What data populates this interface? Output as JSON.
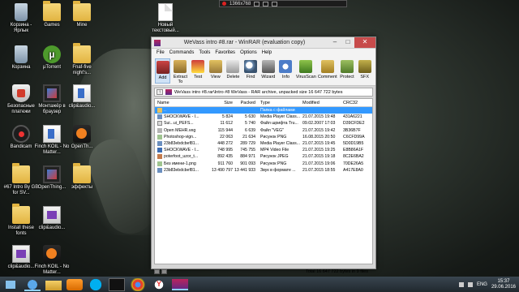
{
  "recording": {
    "resolution": "1366x768"
  },
  "desktop": {
    "icons": [
      {
        "label": "Корзина - Ярлык",
        "icon": "bin-icon"
      },
      {
        "label": "Games",
        "icon": "folder-icon"
      },
      {
        "label": "Mine",
        "icon": "folder-icon"
      },
      {
        "label": "Новый текстовый...",
        "icon": "text-doc-icon"
      },
      {
        "label": "Корзина",
        "icon": "bin-icon"
      },
      {
        "label": "µTorrent",
        "icon": "utorrent-icon"
      },
      {
        "label": "Fnaf-five night's...",
        "icon": "folder-icon"
      },
      {
        "label": "Безопасные платежи",
        "icon": "shield-icon"
      },
      {
        "label": "Монтажёр в браузер",
        "icon": "film-icon"
      },
      {
        "label": "clip&audio...",
        "icon": "media-icon"
      },
      {
        "label": "Bandicam",
        "icon": "bandicam-icon"
      },
      {
        "label": "Finch KOIL - No Matter...",
        "icon": "media-icon"
      },
      {
        "label": "OpenTh...",
        "icon": "klite-icon"
      },
      {
        "label": "#67 Intro By GB for SV...",
        "icon": "folder-icon"
      },
      {
        "label": "OpenThing...",
        "icon": "film-icon"
      },
      {
        "label": "эффекты",
        "icon": "folder-icon"
      },
      {
        "label": "Install these fonts",
        "icon": "folder-icon"
      },
      {
        "label": "clip&audio...",
        "icon": "clip-icon"
      },
      {
        "label": "clip&audio...",
        "icon": "clip-icon"
      },
      {
        "label": "Finch KOIL - No Matter...",
        "icon": "klite-icon"
      }
    ]
  },
  "window": {
    "title": "WeVass intro #8.rar - WinRAR (evaluation copy)",
    "menu": [
      "File",
      "Commands",
      "Tools",
      "Favorites",
      "Options",
      "Help"
    ],
    "tools": [
      {
        "label": "Add",
        "icon": "add-archive-icon"
      },
      {
        "label": "Extract To",
        "icon": "extract-icon"
      },
      {
        "label": "Test",
        "icon": "test-icon"
      },
      {
        "label": "View",
        "icon": "view-icon"
      },
      {
        "label": "Delete",
        "icon": "delete-icon"
      },
      {
        "label": "Find",
        "icon": "find-icon"
      },
      {
        "label": "Wizard",
        "icon": "wizard-icon"
      },
      {
        "label": "Info",
        "icon": "info-icon"
      },
      {
        "label": "VirusScan",
        "icon": "virusscan-icon"
      },
      {
        "label": "Comment",
        "icon": "comment-icon"
      },
      {
        "label": "Protect",
        "icon": "protect-icon"
      },
      {
        "label": "SFX",
        "icon": "sfx-icon"
      }
    ],
    "path": "WeVass intro #8.rar\\Intro #8 WeVass - RAR archive, unpacked size 16 647 722 bytes",
    "columns": {
      "name": "Name",
      "size": "Size",
      "packed": "Packed",
      "type": "Type",
      "modified": "Modified",
      "crc": "CRC32"
    },
    "rows": [
      {
        "name": "..",
        "size": "",
        "packed": "",
        "type": "Папка с файлами",
        "modified": "",
        "crc": "",
        "icon": "folder",
        "selected": true
      },
      {
        "name": "SHOCKWAVE - I...",
        "size": "5 824",
        "packed": "5 630",
        "type": "Media Player Class...",
        "modified": "21.07.2015 19:48",
        "crc": "431A6221",
        "icon": "media",
        "selected": false
      },
      {
        "name": "Sui...ui_PEFS...",
        "size": "11 612",
        "packed": "5 740",
        "type": "Файл шрифта Tru...",
        "modified": "09.02.2007 17:03",
        "crc": "D39CFDE2",
        "icon": "font",
        "selected": false
      },
      {
        "name": "Open MEHR.veg",
        "size": "115 944",
        "packed": "6 639",
        "type": "Файл \"VEG\"",
        "modified": "21.07.2015 19:42",
        "crc": "3B36B7F",
        "icon": "veg",
        "selected": false
      },
      {
        "name": "Photoshop-vign...",
        "size": "22 063",
        "packed": "21 634",
        "type": "Рисунок PNG",
        "modified": "16.08.2015 20:50",
        "crc": "C6CFD99A",
        "icon": "png",
        "selected": false
      },
      {
        "name": "23b83ebdcbef81...",
        "size": "448 272",
        "packed": "289 729",
        "type": "Media Player Class...",
        "modified": "21.07.2015 19:45",
        "crc": "5D0D19B5",
        "icon": "media",
        "selected": false
      },
      {
        "name": "SHOCKWAVE - I...",
        "size": "748 995",
        "packed": "745 755",
        "type": "MP4 Video File",
        "modified": "21.07.2015 19:25",
        "crc": "E8B86A1F",
        "icon": "mp4",
        "selected": false
      },
      {
        "name": "poterfoot_uzor_t...",
        "size": "892 435",
        "packed": "884 971",
        "type": "Рисунок JPEG",
        "modified": "21.07.2015 19:18",
        "crc": "8C2E6BA2",
        "icon": "jpg",
        "selected": false
      },
      {
        "name": "Без имени-1.png",
        "size": "911 760",
        "packed": "901 093",
        "type": "Рисунок PNG",
        "modified": "21.07.2015 19:06",
        "crc": "70DE26A5",
        "icon": "png",
        "selected": false
      },
      {
        "name": "23b83ebdcbef81...",
        "size": "13 490 797",
        "packed": "13 441 933",
        "type": "Звук в формате ...",
        "modified": "21.07.2015 18:55",
        "crc": "A417E8A0",
        "icon": "media",
        "selected": false
      }
    ],
    "status": "Total 16 647 722 bytes in 9 files"
  },
  "taskbar": {
    "apps": [
      "start-icon",
      "internet-explorer-icon",
      "file-explorer-icon",
      "media-player-icon",
      "skype-icon",
      "bandicam-icon",
      "chrome-icon",
      "yandex-icon",
      "winrar-icon"
    ],
    "lang": "ENG",
    "time": "15:37",
    "date": "29.06.2016"
  }
}
